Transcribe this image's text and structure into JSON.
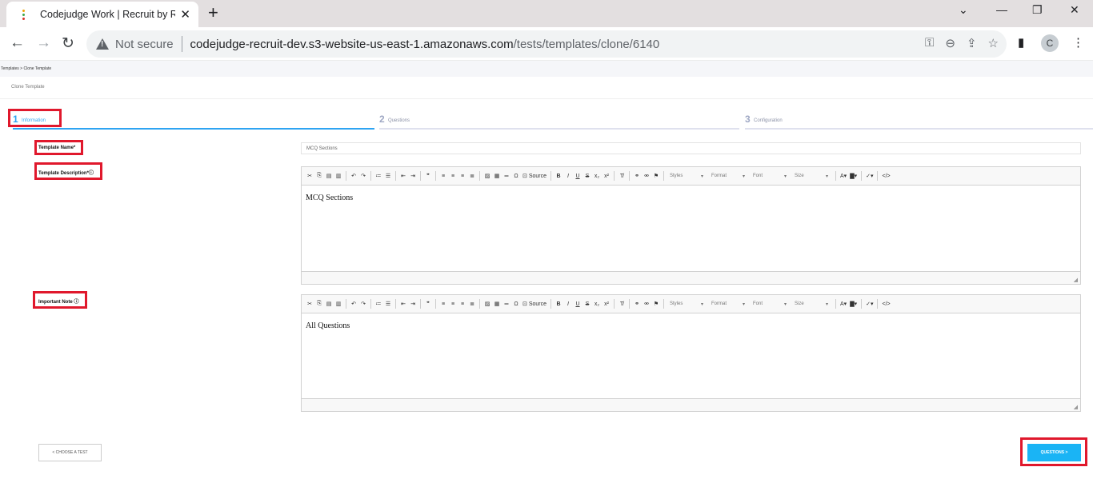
{
  "browser": {
    "tab_title": "Codejudge Work | Recruit by Rea",
    "tab_close": "✕",
    "new_tab": "+",
    "not_secure": "Not secure",
    "url_host": "codejudge-recruit-dev.s3-website-us-east-1.amazonaws.com",
    "url_path": "/tests/templates/clone/6140",
    "profile_initial": "C"
  },
  "breadcrumb": "Templates > Clone Template",
  "page_title": "Clone Template",
  "steps": [
    {
      "num": "1",
      "label": "Information"
    },
    {
      "num": "2",
      "label": "Questions"
    },
    {
      "num": "3",
      "label": "Configuration"
    }
  ],
  "form": {
    "name_label": "Template Name*",
    "name_value": "MCQ Sections",
    "desc_label": "Template Description*",
    "desc_value": "MCQ Sections",
    "note_label": "Important Note",
    "note_value": "All Questions"
  },
  "toolbar": {
    "source": "Source",
    "styles": "Styles",
    "format": "Format",
    "font": "Font",
    "size": "Size"
  },
  "buttons": {
    "back": "< CHOOSE A TEST",
    "next": "QUESTIONS >"
  },
  "colors": {
    "accent": "#2ea4f2",
    "highlight": "#e0182c",
    "primary_button": "#1ab4f5"
  }
}
